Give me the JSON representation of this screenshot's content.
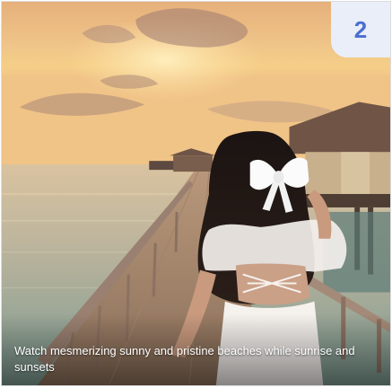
{
  "slide": {
    "number": "2",
    "caption": "Watch mesmerizing sunny and pristine beaches while sunrise and sunsets"
  },
  "colors": {
    "badge_bg": "#e9eef9",
    "badge_text": "#4a6fd1",
    "caption_text": "#ffffff"
  }
}
